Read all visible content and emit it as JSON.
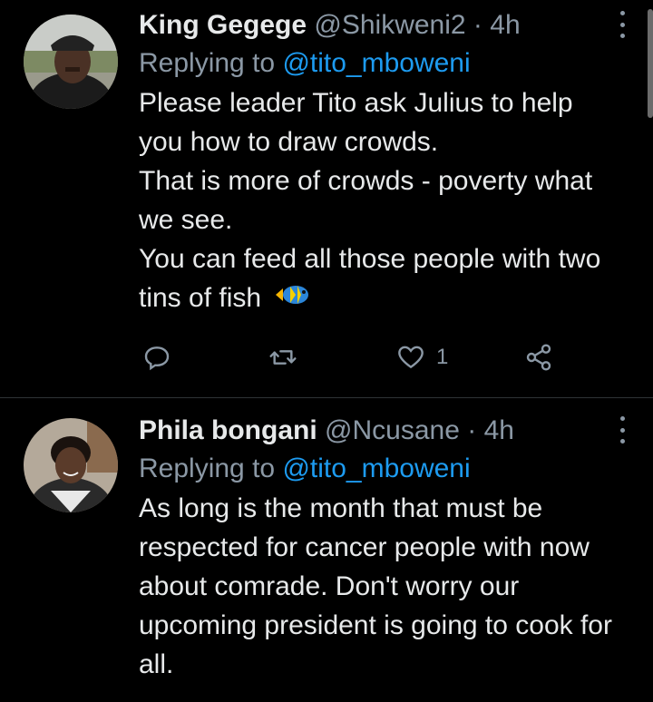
{
  "tweets": [
    {
      "name": "King Gegege",
      "handle": "@Shikweni2",
      "dot": "·",
      "time": "4h",
      "replying_prefix": "Replying to",
      "replying_to": "@tito_mboweni",
      "lines": [
        "Please leader Tito ask Julius to help you how to draw crowds.",
        "That is more of crowds - poverty what we see.",
        "You can feed all those people with two tins of fish"
      ],
      "emoji": "fish-emoji",
      "like_count": "1",
      "icons": [
        "reply-icon",
        "retweet-icon",
        "like-icon",
        "share-icon"
      ]
    },
    {
      "name": "Phila bongani",
      "handle": "@Ncusane",
      "dot": "·",
      "time": "4h",
      "replying_prefix": "Replying to",
      "replying_to": "@tito_mboweni",
      "lines": [
        "As long is the month that must be respected for cancer people with now about comrade. Don't worry our upcoming president is going to cook for all."
      ]
    }
  ],
  "colors": {
    "background": "#000000",
    "text": "#e7e9ea",
    "secondary": "#8b98a5",
    "link": "#1d9bf0",
    "divider": "#2f3336"
  }
}
